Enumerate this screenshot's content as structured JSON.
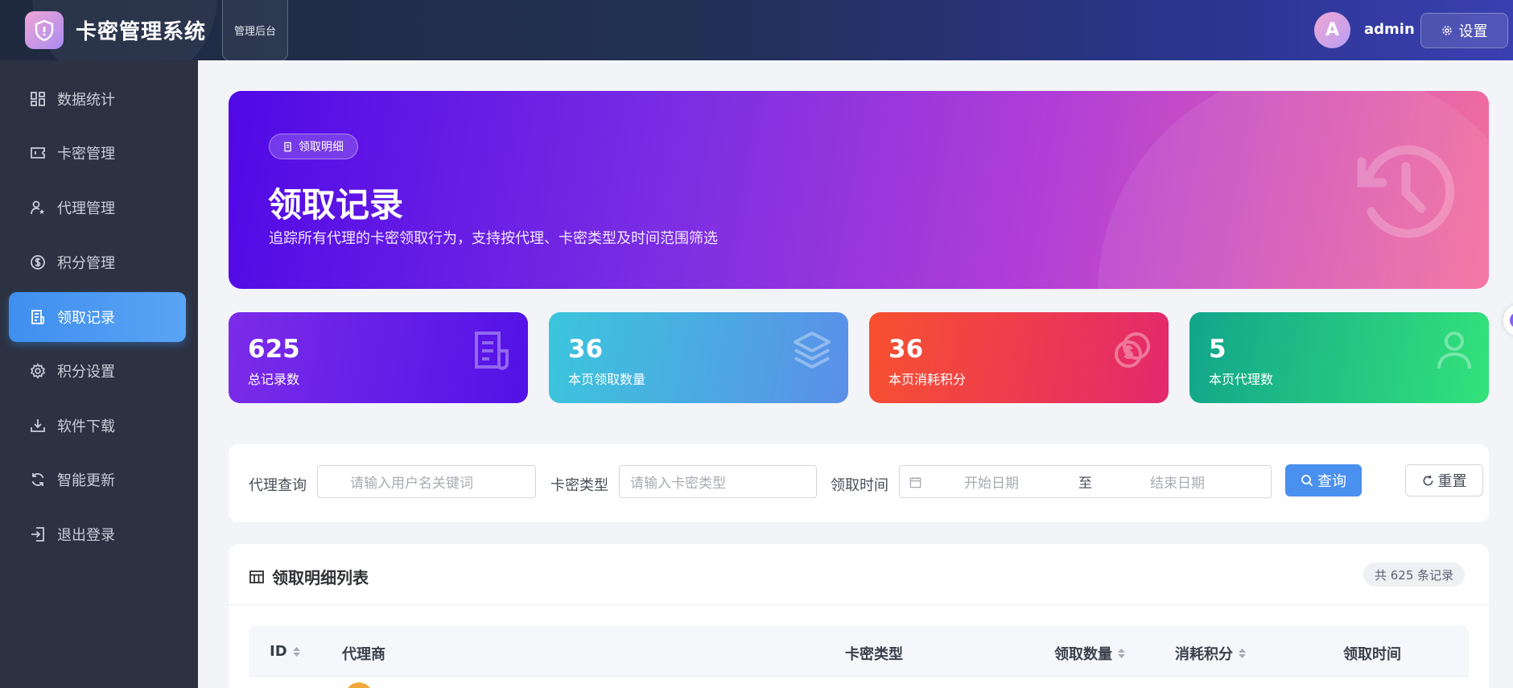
{
  "header": {
    "app_title": "卡密管理系统",
    "admin_badge": "管理后台",
    "avatar_letter": "A",
    "username": "admin",
    "settings_label": "设置"
  },
  "sidebar": {
    "items": [
      {
        "label": "数据统计",
        "icon": "dashboard-icon"
      },
      {
        "label": "卡密管理",
        "icon": "ticket-icon"
      },
      {
        "label": "代理管理",
        "icon": "user-star-icon"
      },
      {
        "label": "积分管理",
        "icon": "coin-icon"
      },
      {
        "label": "领取记录",
        "icon": "document-icon",
        "active": true
      },
      {
        "label": "积分设置",
        "icon": "gear-icon"
      },
      {
        "label": "软件下载",
        "icon": "download-icon"
      },
      {
        "label": "智能更新",
        "icon": "refresh-icon"
      },
      {
        "label": "退出登录",
        "icon": "logout-icon"
      }
    ]
  },
  "banner": {
    "chip": "领取明细",
    "title": "领取记录",
    "subtitle": "追踪所有代理的卡密领取行为，支持按代理、卡密类型及时间范围筛选"
  },
  "stats": [
    {
      "value": "625",
      "label": "总记录数",
      "icon": "document-icon"
    },
    {
      "value": "36",
      "label": "本页领取数量",
      "icon": "layers-icon"
    },
    {
      "value": "36",
      "label": "本页消耗积分",
      "icon": "coins-icon"
    },
    {
      "value": "5",
      "label": "本页代理数",
      "icon": "user-icon"
    }
  ],
  "filter": {
    "agent_label": "代理查询",
    "agent_placeholder": "请输入用户名关键词",
    "type_label": "卡密类型",
    "type_placeholder": "请输入卡密类型",
    "time_label": "领取时间",
    "start_placeholder": "开始日期",
    "range_sep": "至",
    "end_placeholder": "结束日期",
    "query_label": "查询",
    "reset_label": "重置"
  },
  "table": {
    "title": "领取明细列表",
    "count_text": "共 625 条记录",
    "columns": [
      "ID",
      "代理商",
      "卡密类型",
      "领取数量",
      "消耗积分",
      "领取时间"
    ]
  },
  "colors": {
    "accent": "#4a90ef",
    "sidebar_bg": "#2c3242"
  }
}
